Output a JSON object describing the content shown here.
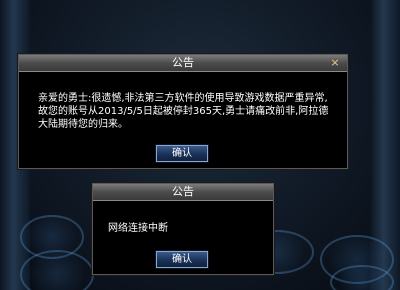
{
  "dialog1": {
    "title": "公告",
    "close_glyph": "×",
    "message": "亲爱的勇士:很遗憾,非法第三方软件的使用导致游戏数据严重异常,故您的账号从2013/5/5日起被停封365天,勇士请痛改前非,阿拉德大陆期待您的归来。",
    "confirm_label": "确认"
  },
  "dialog2": {
    "title": "公告",
    "message": "网络连接中断",
    "confirm_label": "确认"
  }
}
